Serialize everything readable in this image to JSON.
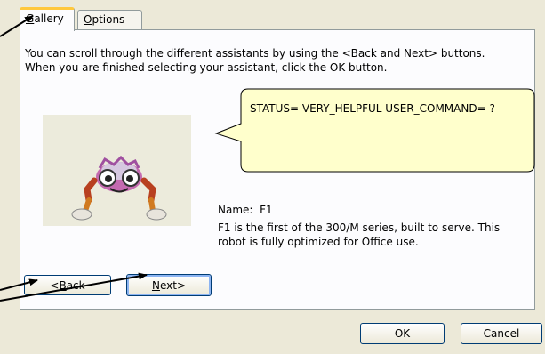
{
  "tabs": [
    {
      "label_first": "G",
      "label_rest": "allery"
    },
    {
      "label_first": "O",
      "label_rest": "ptions"
    }
  ],
  "instructions": {
    "line1": "You can scroll through the different assistants by using the <Back and Next> buttons.",
    "line2": "When you are finished selecting your assistant, click the OK button."
  },
  "bubble": {
    "text": "STATUS= VERY_HELPFUL  USER_COMMAND= ?"
  },
  "assistant": {
    "name_label": "Name:",
    "name_value": "F1",
    "description_line1": "F1 is the first of the 300/M series, built to serve. This",
    "description_line2": "robot is fully optimized for Office use."
  },
  "buttons": {
    "back": {
      "prefix": "<",
      "mnemonic": "B",
      "rest": "ack"
    },
    "next": {
      "mnemonic": "N",
      "rest": "ext",
      "suffix": ">"
    },
    "ok": "OK",
    "cancel": "Cancel"
  },
  "colors": {
    "window_bg": "#ece9d8",
    "panel_bg": "#fcfcfe",
    "bubble_fill": "#ffffcc",
    "tab_accent": "#ffc83c"
  },
  "icons": {
    "assistant": "f1-robot-icon",
    "callout": "speech-bubble-shape"
  }
}
